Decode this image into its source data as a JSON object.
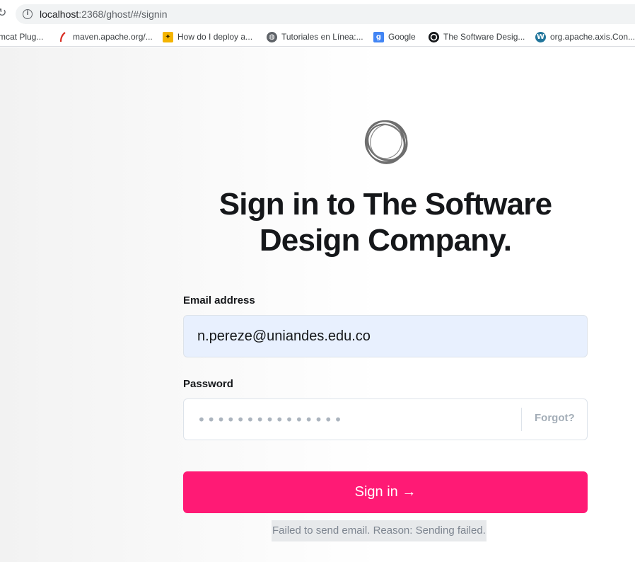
{
  "browser": {
    "url_host": "localhost",
    "url_path": ":2368/ghost/#/signin",
    "bookmarks": [
      {
        "label": "mcat Plug...",
        "icon": "tomcat-icon"
      },
      {
        "label": "maven.apache.org/...",
        "icon": "feather-icon"
      },
      {
        "label": "How do I deploy a...",
        "icon": "stack-icon"
      },
      {
        "label": "Tutoriales en Línea:...",
        "icon": "globe-icon"
      },
      {
        "label": "Google",
        "icon": "google-icon"
      },
      {
        "label": "The Software Desig...",
        "icon": "ghost-site-icon"
      },
      {
        "label": "org.apache.axis.Con...",
        "icon": "wordpress-icon"
      }
    ]
  },
  "signin": {
    "title_line1": "Sign in to The Software",
    "title_line2": "Design Company.",
    "email_label": "Email address",
    "email_value": "n.pereze@uniandes.edu.co",
    "password_label": "Password",
    "password_value": "•••••••••••••••",
    "forgot_label": "Forgot?",
    "submit_label": "Sign in →",
    "error_message": "Failed to send email. Reason: Sending failed."
  },
  "colors": {
    "accent": "#ff1a75",
    "email_fill": "#e8f0fe",
    "error_bg": "#e7e9eb"
  }
}
